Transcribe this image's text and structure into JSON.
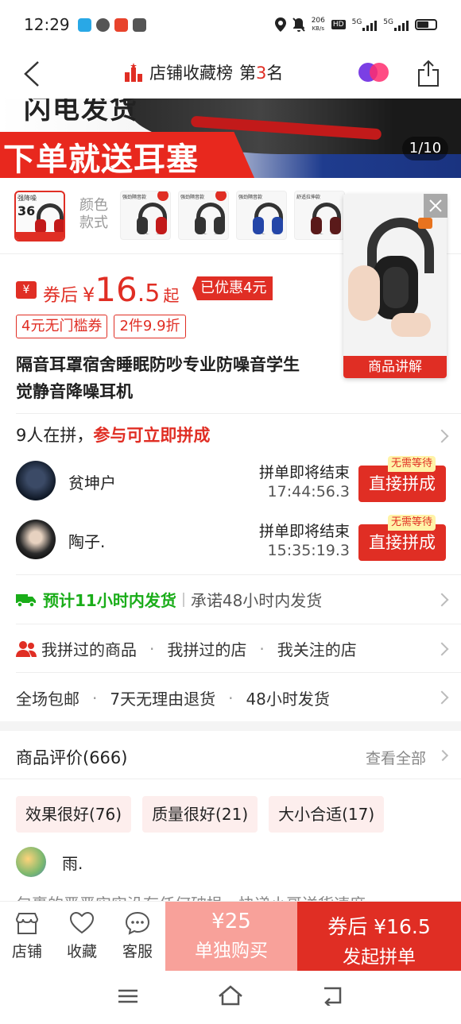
{
  "status_bar": {
    "time": "12:29",
    "net_speed_value": "206",
    "net_speed_unit": "KB/s",
    "hd": "HD",
    "sig1": "5G",
    "sig2": "5G"
  },
  "nav": {
    "store_rank_label": "店铺收藏榜",
    "rank_prefix": "第",
    "rank_number": "3",
    "rank_suffix": "名"
  },
  "banner": {
    "top_text": "闪电发货",
    "title": "下单就送耳塞",
    "page_indicator": "1/10"
  },
  "sku": {
    "main_label": "强降噪",
    "main_big": "36",
    "label": "颜色款式",
    "label_line1": "颜色",
    "label_line2": "款式",
    "thumbs": [
      {
        "text": "强劲隔音款"
      },
      {
        "text": "强劲隔音款"
      },
      {
        "text": "强劲隔音款"
      },
      {
        "text": "舒适拉伸款"
      }
    ]
  },
  "float_video": {
    "label": "商品讲解"
  },
  "price": {
    "coupon_icon": "¥",
    "prefix": "券后",
    "yen": "¥",
    "amount_int": "16",
    "amount_dec": ".5",
    "suffix": "起",
    "discount": "已优惠4元"
  },
  "coupons": [
    "4元无门槛券",
    "2件9.9折"
  ],
  "product": {
    "title_line1": "隔音耳罩宿舍睡眠防吵专业防噪音学生",
    "title_line2": "觉静音降噪耳机"
  },
  "group": {
    "count_text": "9人在拼，",
    "cta_text": "参与可立即拼成",
    "rows": [
      {
        "name": "贫坤户",
        "status": "拼单即将结束",
        "timer": "17:44:56.3",
        "button": "直接拼成",
        "badge": "无需等待"
      },
      {
        "name": "陶子.",
        "status": "拼单即将结束",
        "timer": "15:35:19.3",
        "button": "直接拼成",
        "badge": "无需等待"
      }
    ]
  },
  "shipping": {
    "estimate": "预计11小时内发货",
    "promise": "承诺48小时内发货"
  },
  "history": [
    "我拼过的商品",
    "我拼过的店",
    "我关注的店"
  ],
  "history_sep": "·",
  "services": [
    "全场包邮",
    "7天无理由退货",
    "48小时发货"
  ],
  "reviews": {
    "title": "商品评价(666)",
    "view_all": "查看全部",
    "tags": [
      "效果很好(76)",
      "质量很好(21)",
      "大小合适(17)"
    ],
    "user": "雨.",
    "snippet": "包裹的严严实实没有任何破损，快递小哥送货速度"
  },
  "bottom_bar": {
    "store": "店铺",
    "favorite": "收藏",
    "service": "客服",
    "alone_price": "¥25",
    "alone_label": "单独购买",
    "group_price": "券后 ¥16.5",
    "group_label": "发起拼单"
  },
  "colors": {
    "brand_red": "#e02e24",
    "green": "#1aad19",
    "alone_pink": "#f8a19a"
  }
}
